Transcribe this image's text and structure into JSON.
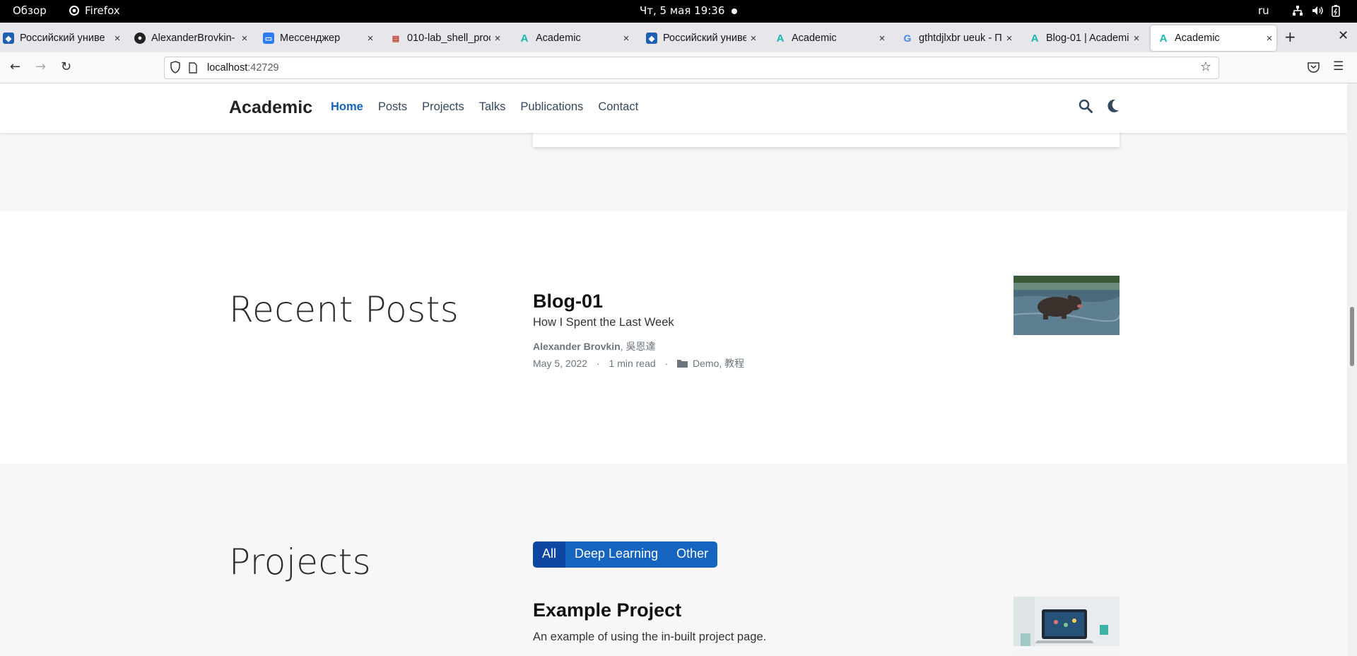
{
  "system": {
    "overview": "Обзор",
    "app_name": "Firefox",
    "clock": "Чт, 5 мая  19:36",
    "lang": "ru"
  },
  "tabs": [
    {
      "title": "Российский униве",
      "favicon": "rudn-icon"
    },
    {
      "title": "AlexanderBrovkin-",
      "favicon": "github-icon"
    },
    {
      "title": "Мессенджер",
      "favicon": "messenger-icon"
    },
    {
      "title": "010-lab_shell_proc",
      "favicon": "pdf-icon"
    },
    {
      "title": "Academic",
      "favicon": "academic-icon"
    },
    {
      "title": "Российский униве",
      "favicon": "rudn-icon"
    },
    {
      "title": "Academic",
      "favicon": "academic-icon"
    },
    {
      "title": "gthtdjlxbr ueuk - П",
      "favicon": "google-icon"
    },
    {
      "title": "Blog-01 | Academic",
      "favicon": "academic-icon"
    },
    {
      "title": "Academic",
      "favicon": "academic-icon",
      "active": true
    }
  ],
  "url": {
    "host": "localhost",
    "port": ":42729"
  },
  "site": {
    "brand": "Academic",
    "menu": [
      "Home",
      "Posts",
      "Projects",
      "Talks",
      "Publications",
      "Contact"
    ],
    "active_menu": "Home",
    "accent_color": "#1565c0"
  },
  "recent_posts": {
    "heading": "Recent Posts",
    "post": {
      "title": "Blog-01",
      "summary": "How I Spent the Last Week",
      "author": "Alexander Brovkin",
      "author_extra": ", 吳恩達",
      "date": "May 5, 2022",
      "read_time": "1 min read",
      "categories": "Demo, 教程",
      "separator": "·"
    }
  },
  "projects": {
    "heading": "Projects",
    "filters": [
      "All",
      "Deep Learning",
      "Other"
    ],
    "active_filter": "All",
    "item": {
      "title": "Example Project",
      "summary": "An example of using the in-built project page."
    }
  }
}
